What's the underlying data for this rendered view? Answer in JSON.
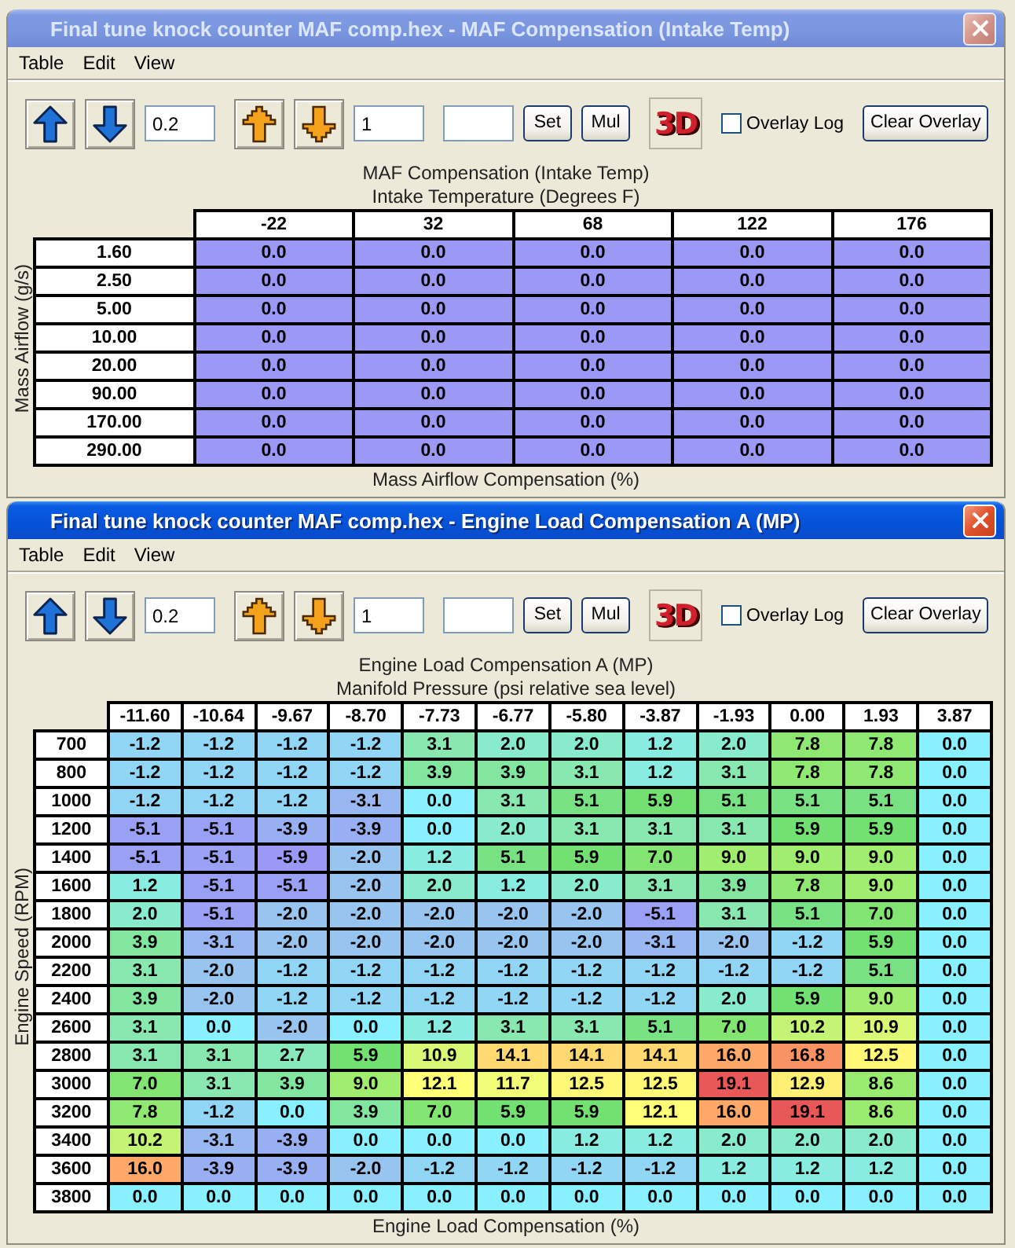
{
  "windows": [
    {
      "title": "Final tune knock counter MAF comp.hex - MAF Compensation (Intake Temp)",
      "active": false,
      "menu": [
        "Table",
        "Edit",
        "View"
      ],
      "toolbar": [
        [
          {
            "kind": "increase"
          },
          {
            "kind": "decrease"
          },
          {
            "kind": "field",
            "value": "0.2"
          }
        ],
        [
          {
            "kind": "increase_coarse"
          },
          {
            "kind": "decrease_coarse"
          },
          {
            "kind": "field",
            "value": "1"
          }
        ],
        [
          {
            "kind": "field"
          },
          {
            "kind": "button",
            "label": "Set"
          },
          {
            "kind": "button",
            "label": "Mul"
          }
        ],
        [
          {
            "kind": "view3d",
            "label": "3D"
          }
        ],
        [
          {
            "kind": "checkbox",
            "label": "Overlay Log",
            "checked": false
          }
        ],
        [
          {
            "kind": "button",
            "label": "Clear Overlay"
          }
        ]
      ],
      "table": {
        "title": "MAF Compensation (Intake Temp)",
        "x_axis": "Intake Temperature (Degrees F)",
        "y_axis": "Mass Airflow (g/s)",
        "value_label": "Mass Airflow Compensation (%)",
        "columns": [
          "-22",
          "32",
          "68",
          "122",
          "176"
        ],
        "rows": [
          {
            "label": "1.60",
            "values": [
              "0.0",
              "0.0",
              "0.0",
              "0.0",
              "0.0"
            ]
          },
          {
            "label": "2.50",
            "values": [
              "0.0",
              "0.0",
              "0.0",
              "0.0",
              "0.0"
            ]
          },
          {
            "label": "5.00",
            "values": [
              "0.0",
              "0.0",
              "0.0",
              "0.0",
              "0.0"
            ]
          },
          {
            "label": "10.00",
            "values": [
              "0.0",
              "0.0",
              "0.0",
              "0.0",
              "0.0"
            ]
          },
          {
            "label": "20.00",
            "values": [
              "0.0",
              "0.0",
              "0.0",
              "0.0",
              "0.0"
            ]
          },
          {
            "label": "90.00",
            "values": [
              "0.0",
              "0.0",
              "0.0",
              "0.0",
              "0.0"
            ]
          },
          {
            "label": "170.00",
            "values": [
              "0.0",
              "0.0",
              "0.0",
              "0.0",
              "0.0"
            ]
          },
          {
            "label": "290.00",
            "values": [
              "0.0",
              "0.0",
              "0.0",
              "0.0",
              "0.0"
            ]
          }
        ]
      }
    },
    {
      "title": "Final tune knock counter MAF comp.hex - Engine Load Compensation A (MP)",
      "active": true,
      "menu": [
        "Table",
        "Edit",
        "View"
      ],
      "toolbar": [
        [
          {
            "kind": "increase"
          },
          {
            "kind": "decrease"
          },
          {
            "kind": "field",
            "value": "0.2"
          }
        ],
        [
          {
            "kind": "increase_coarse"
          },
          {
            "kind": "decrease_coarse"
          },
          {
            "kind": "field",
            "value": "1"
          }
        ],
        [
          {
            "kind": "field"
          },
          {
            "kind": "button",
            "label": "Set"
          },
          {
            "kind": "button",
            "label": "Mul"
          }
        ],
        [
          {
            "kind": "view3d",
            "label": "3D"
          }
        ],
        [
          {
            "kind": "checkbox",
            "label": "Overlay Log",
            "checked": false
          }
        ],
        [
          {
            "kind": "button",
            "label": "Clear Overlay"
          }
        ]
      ],
      "table": {
        "title": "Engine Load Compensation A (MP)",
        "x_axis": "Manifold Pressure (psi relative sea level)",
        "y_axis": "Engine Speed (RPM)",
        "value_label": "Engine Load Compensation (%)",
        "columns": [
          "-11.60",
          "-10.64",
          "-9.67",
          "-8.70",
          "-7.73",
          "-6.77",
          "-5.80",
          "-3.87",
          "-1.93",
          "0.00",
          "1.93",
          "3.87"
        ],
        "rows": [
          {
            "label": "700",
            "values": [
              "-1.2",
              "-1.2",
              "-1.2",
              "-1.2",
              "3.1",
              "2.0",
              "2.0",
              "1.2",
              "2.0",
              "7.8",
              "7.8",
              "0.0"
            ]
          },
          {
            "label": "800",
            "values": [
              "-1.2",
              "-1.2",
              "-1.2",
              "-1.2",
              "3.9",
              "3.9",
              "3.1",
              "1.2",
              "3.1",
              "7.8",
              "7.8",
              "0.0"
            ]
          },
          {
            "label": "1000",
            "values": [
              "-1.2",
              "-1.2",
              "-1.2",
              "-3.1",
              "0.0",
              "3.1",
              "5.1",
              "5.9",
              "5.1",
              "5.1",
              "5.1",
              "0.0"
            ]
          },
          {
            "label": "1200",
            "values": [
              "-5.1",
              "-5.1",
              "-3.9",
              "-3.9",
              "0.0",
              "2.0",
              "3.1",
              "3.1",
              "3.1",
              "5.9",
              "5.9",
              "0.0"
            ]
          },
          {
            "label": "1400",
            "values": [
              "-5.1",
              "-5.1",
              "-5.9",
              "-2.0",
              "1.2",
              "5.1",
              "5.9",
              "7.0",
              "9.0",
              "9.0",
              "9.0",
              "0.0"
            ]
          },
          {
            "label": "1600",
            "values": [
              "1.2",
              "-5.1",
              "-5.1",
              "-2.0",
              "2.0",
              "1.2",
              "2.0",
              "3.1",
              "3.9",
              "7.8",
              "9.0",
              "0.0"
            ]
          },
          {
            "label": "1800",
            "values": [
              "2.0",
              "-5.1",
              "-2.0",
              "-2.0",
              "-2.0",
              "-2.0",
              "-2.0",
              "-5.1",
              "3.1",
              "5.1",
              "7.0",
              "0.0"
            ]
          },
          {
            "label": "2000",
            "values": [
              "3.9",
              "-3.1",
              "-2.0",
              "-2.0",
              "-2.0",
              "-2.0",
              "-2.0",
              "-3.1",
              "-2.0",
              "-1.2",
              "5.9",
              "0.0"
            ]
          },
          {
            "label": "2200",
            "values": [
              "3.1",
              "-2.0",
              "-1.2",
              "-1.2",
              "-1.2",
              "-1.2",
              "-1.2",
              "-1.2",
              "-1.2",
              "-1.2",
              "5.1",
              "0.0"
            ]
          },
          {
            "label": "2400",
            "values": [
              "3.9",
              "-2.0",
              "-1.2",
              "-1.2",
              "-1.2",
              "-1.2",
              "-1.2",
              "-1.2",
              "2.0",
              "5.9",
              "9.0",
              "0.0"
            ]
          },
          {
            "label": "2600",
            "values": [
              "3.1",
              "0.0",
              "-2.0",
              "0.0",
              "1.2",
              "3.1",
              "3.1",
              "5.1",
              "7.0",
              "10.2",
              "10.9",
              "0.0"
            ]
          },
          {
            "label": "2800",
            "values": [
              "3.1",
              "3.1",
              "2.7",
              "5.9",
              "10.9",
              "14.1",
              "14.1",
              "14.1",
              "16.0",
              "16.8",
              "12.5",
              "0.0"
            ]
          },
          {
            "label": "3000",
            "values": [
              "7.0",
              "3.1",
              "3.9",
              "9.0",
              "12.1",
              "11.7",
              "12.5",
              "12.5",
              "19.1",
              "12.9",
              "8.6",
              "0.0"
            ]
          },
          {
            "label": "3200",
            "values": [
              "7.8",
              "-1.2",
              "0.0",
              "3.9",
              "7.0",
              "5.9",
              "5.9",
              "12.1",
              "16.0",
              "19.1",
              "8.6",
              "0.0"
            ]
          },
          {
            "label": "3400",
            "values": [
              "10.2",
              "-3.1",
              "-3.9",
              "0.0",
              "0.0",
              "0.0",
              "1.2",
              "1.2",
              "2.0",
              "2.0",
              "2.0",
              "0.0"
            ]
          },
          {
            "label": "3600",
            "values": [
              "16.0",
              "-3.9",
              "-3.9",
              "-2.0",
              "-1.2",
              "-1.2",
              "-1.2",
              "-1.2",
              "1.2",
              "1.2",
              "1.2",
              "0.0"
            ]
          },
          {
            "label": "3800",
            "values": [
              "0.0",
              "0.0",
              "0.0",
              "0.0",
              "0.0",
              "0.0",
              "0.0",
              "0.0",
              "0.0",
              "0.0",
              "0.0",
              "0.0"
            ]
          }
        ]
      }
    }
  ]
}
